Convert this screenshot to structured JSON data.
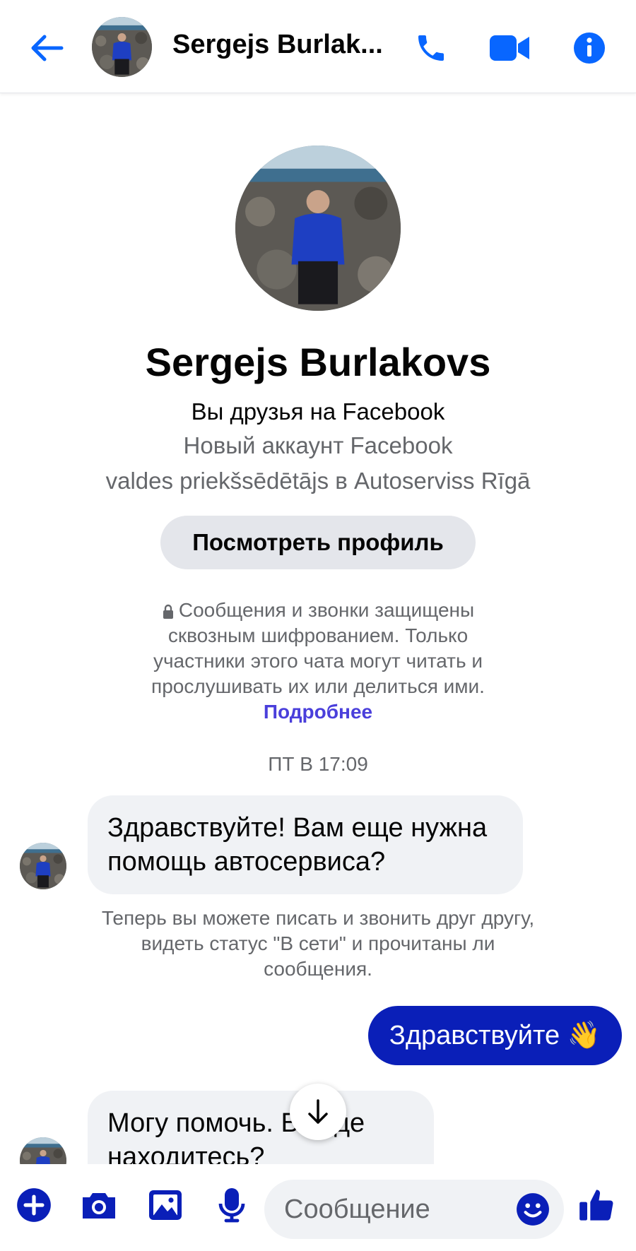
{
  "header": {
    "title": "Sergejs Burlak...",
    "icons": [
      "back-arrow-icon",
      "phone-icon",
      "video-camera-icon",
      "info-icon"
    ]
  },
  "profile": {
    "name": "Sergejs Burlakovs",
    "friends_status": "Вы друзья на Facebook",
    "account_note": "Новый аккаунт Facebook",
    "work": "valdes priekšsēdētājs в Autoserviss Rīgā",
    "view_profile_label": "Посмотреть профиль"
  },
  "encryption": {
    "text": "Сообщения и звонки защищены сквозным шифрованием. Только участники этого чата могут читать и прослушивать их или делиться ими.",
    "link": "Подробнее"
  },
  "timestamp": "ПТ В 17:09",
  "messages": {
    "m1": "Здравствуйте! Вам еще нужна помощь автосервиса?",
    "system_note": "Теперь вы можете писать и звонить друг другу, видеть статус \"В сети\" и прочитаны ли сообщения.",
    "m2": "Здравствуйте 👋",
    "m3": "Могу помочь. Вы где находитесь?"
  },
  "composer": {
    "placeholder": "Сообщение",
    "icons": [
      "plus-icon",
      "camera-icon",
      "gallery-icon",
      "microphone-icon",
      "emoji-icon",
      "like-icon"
    ]
  },
  "colors": {
    "accent": "#0a1fb8",
    "header_icons": "#0866ff",
    "link": "#4a3fdb",
    "muted_text": "#65676b",
    "bubble_in": "#f0f2f5"
  }
}
